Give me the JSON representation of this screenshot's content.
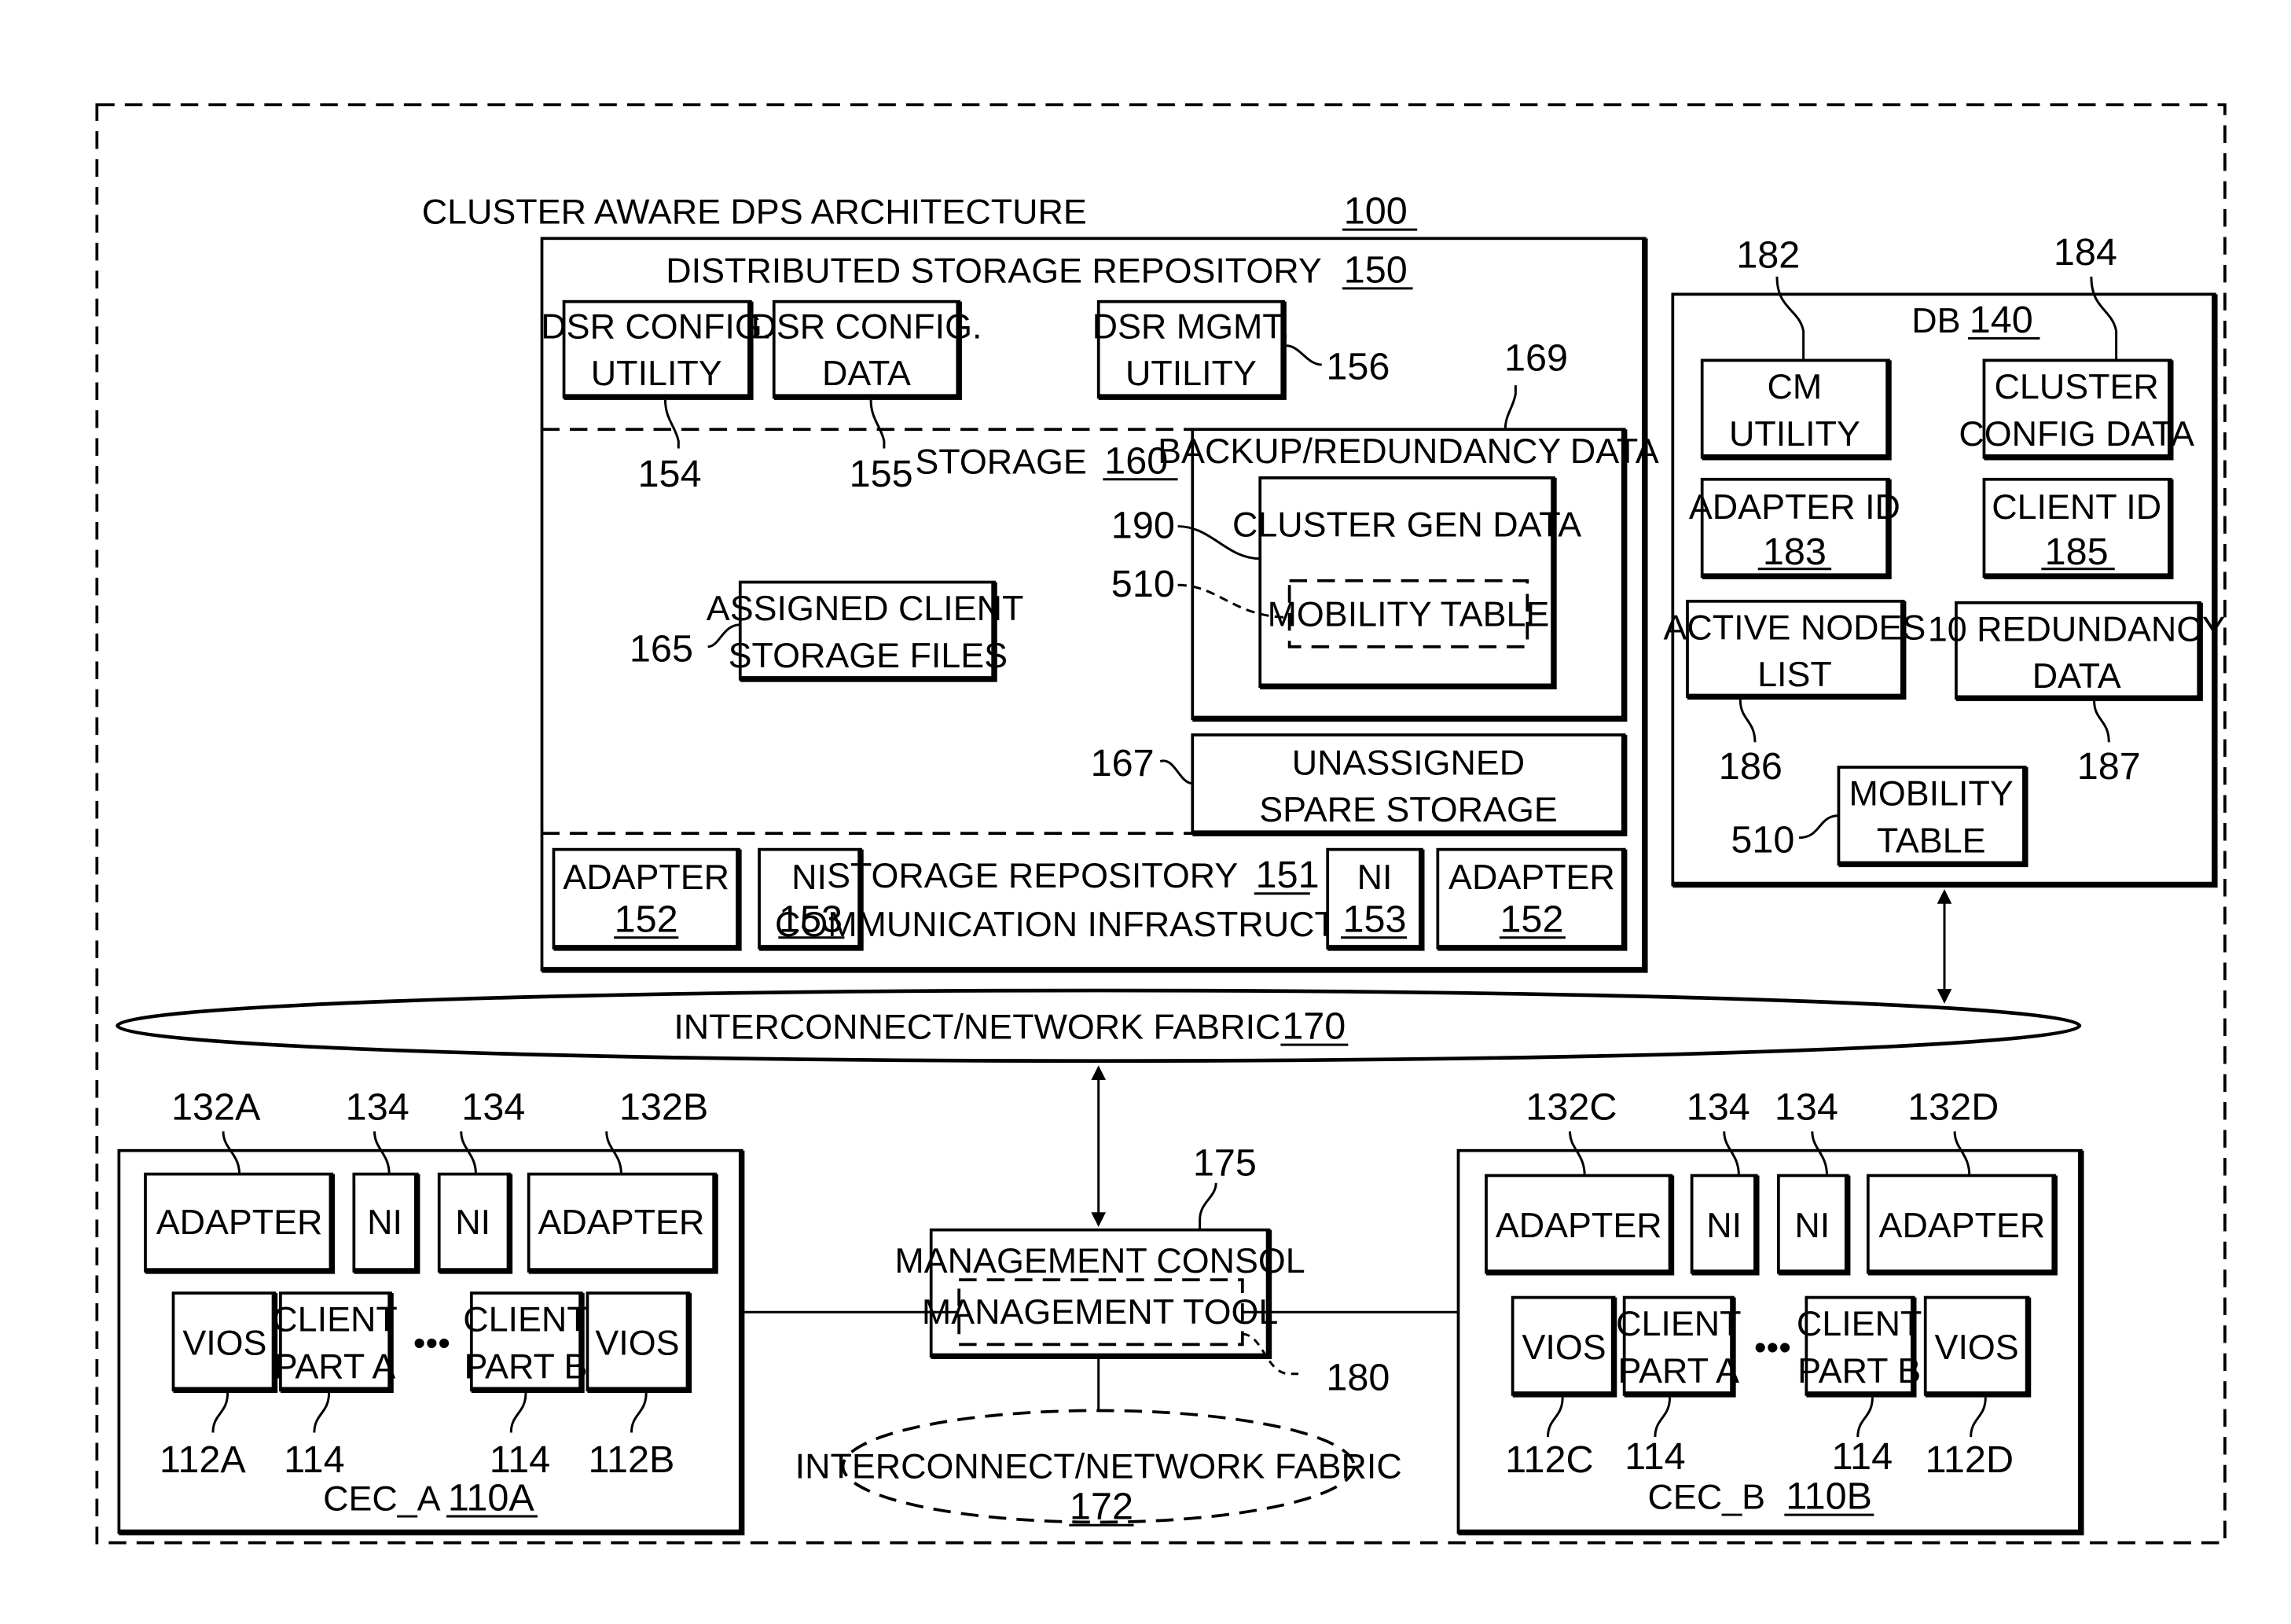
{
  "title": {
    "text": "CLUSTER AWARE DPS ARCHITECTURE",
    "ref": "100"
  },
  "dsr": {
    "title": "DISTRIBUTED STORAGE REPOSITORY",
    "ref": "150",
    "config_utility": {
      "line1": "DSR CONFIG.",
      "line2": "UTILITY",
      "ref": "154"
    },
    "config_data": {
      "line1": "DSR CONFIG.",
      "line2": "DATA",
      "ref": "155"
    },
    "mgmt_utility": {
      "line1": "DSR MGMT.",
      "line2": "UTILITY",
      "ref": "156"
    },
    "storage": {
      "label": "STORAGE",
      "ref": "160"
    },
    "backup": {
      "label": "BACKUP/REDUNDANCY DATA",
      "ref": "169"
    },
    "cluster_gen": {
      "label": "CLUSTER GEN DATA",
      "ref": "190"
    },
    "mobility_table": {
      "label": "MOBILITY TABLE",
      "ref": "510"
    },
    "assigned": {
      "line1": "ASSIGNED CLIENT",
      "line2": "STORAGE FILES",
      "ref": "165"
    },
    "unassigned": {
      "line1": "UNASSIGNED",
      "line2": "SPARE STORAGE",
      "ref": "167"
    },
    "comm": {
      "line1": "STORAGE REPOSITORY",
      "ref": "151",
      "line2": "COMMUNICATION INFRASTRUCTURE"
    },
    "adapter_left": {
      "label": "ADAPTER",
      "ref": "152"
    },
    "ni_left": {
      "label": "NI",
      "ref": "153"
    },
    "ni_right": {
      "label": "NI",
      "ref": "153"
    },
    "adapter_right": {
      "label": "ADAPTER",
      "ref": "152"
    }
  },
  "db": {
    "title": "DB",
    "ref": "140",
    "cm_utility": {
      "line1": "CM",
      "line2": "UTILITY",
      "ref": "182"
    },
    "cluster_config": {
      "line1": "CLUSTER",
      "line2": "CONFIG DATA",
      "ref": "184"
    },
    "adapter_id": {
      "line1": "ADAPTER ID",
      "ref": "183"
    },
    "client_id": {
      "line1": "CLIENT ID",
      "ref": "185"
    },
    "active_nodes": {
      "line1": "ACTIVE NODES",
      "line2": "LIST",
      "ref": "186"
    },
    "io_redundancy": {
      "line1": "10 REDUNDANCY",
      "line2": "DATA",
      "ref": "187"
    },
    "mobility": {
      "line1": "MOBILITY",
      "line2": "TABLE",
      "ref": "510"
    }
  },
  "fabric": {
    "label": "INTERCONNECT/NETWORK FABRIC",
    "ref": "170"
  },
  "fabric2": {
    "label": "INTERCONNECT/NETWORK FABRIC",
    "ref": "172"
  },
  "mgmt": {
    "console": "MANAGEMENT CONSOL",
    "tool": "MANAGEMENT TOOL",
    "ref_console": "175",
    "ref_tool": "180"
  },
  "cec_a": {
    "label": "CEC_A",
    "ref": "110A",
    "adapter1": {
      "label": "ADAPTER",
      "ref": "132A"
    },
    "ni1": {
      "label": "NI",
      "ref": "134"
    },
    "ni2": {
      "label": "NI",
      "ref": "134"
    },
    "adapter2": {
      "label": "ADAPTER",
      "ref": "132B"
    },
    "vios1": {
      "label": "VIOS",
      "ref": "112A"
    },
    "client_a": {
      "line1": "CLIENT",
      "line2": "PART A",
      "ref": "114"
    },
    "client_b": {
      "line1": "CLIENT",
      "line2": "PART B",
      "ref": "114"
    },
    "vios2": {
      "label": "VIOS",
      "ref": "112B"
    },
    "ellipsis": "•••"
  },
  "cec_b": {
    "label": "CEC_B",
    "ref": "110B",
    "adapter1": {
      "label": "ADAPTER",
      "ref": "132C"
    },
    "ni1": {
      "label": "NI",
      "ref": "134"
    },
    "ni2": {
      "label": "NI",
      "ref": "134"
    },
    "adapter2": {
      "label": "ADAPTER",
      "ref": "132D"
    },
    "vios1": {
      "label": "VIOS",
      "ref": "112C"
    },
    "client_a": {
      "line1": "CLIENT",
      "line2": "PART A",
      "ref": "114"
    },
    "client_b": {
      "line1": "CLIENT",
      "line2": "PART B",
      "ref": "114"
    },
    "vios2": {
      "label": "VIOS",
      "ref": "112D"
    },
    "ellipsis": "•••"
  }
}
